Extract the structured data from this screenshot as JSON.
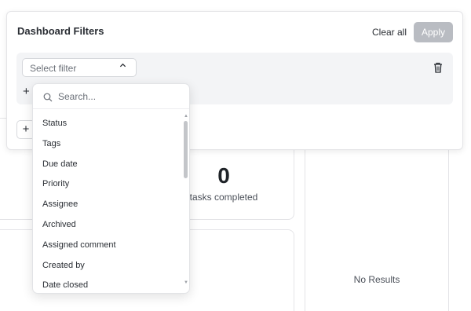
{
  "panel": {
    "title": "Dashboard Filters",
    "clear_all_label": "Clear all",
    "apply_label": "Apply"
  },
  "filter_row": {
    "select_placeholder": "Select filter",
    "add_label": "+"
  },
  "add_group_label": "+",
  "dropdown": {
    "search_placeholder": "Search...",
    "options": [
      "Status",
      "Tags",
      "Due date",
      "Priority",
      "Assignee",
      "Archived",
      "Assigned comment",
      "Created by",
      "Date closed"
    ]
  },
  "background": {
    "tasks_completed_count": "0",
    "tasks_completed_label": "tasks completed",
    "no_results_label": "No Results"
  },
  "colors": {
    "apply_disabled_bg": "#b9bcc2",
    "filter_row_bg": "#f3f4f6",
    "text_primary": "#2a2e34"
  }
}
